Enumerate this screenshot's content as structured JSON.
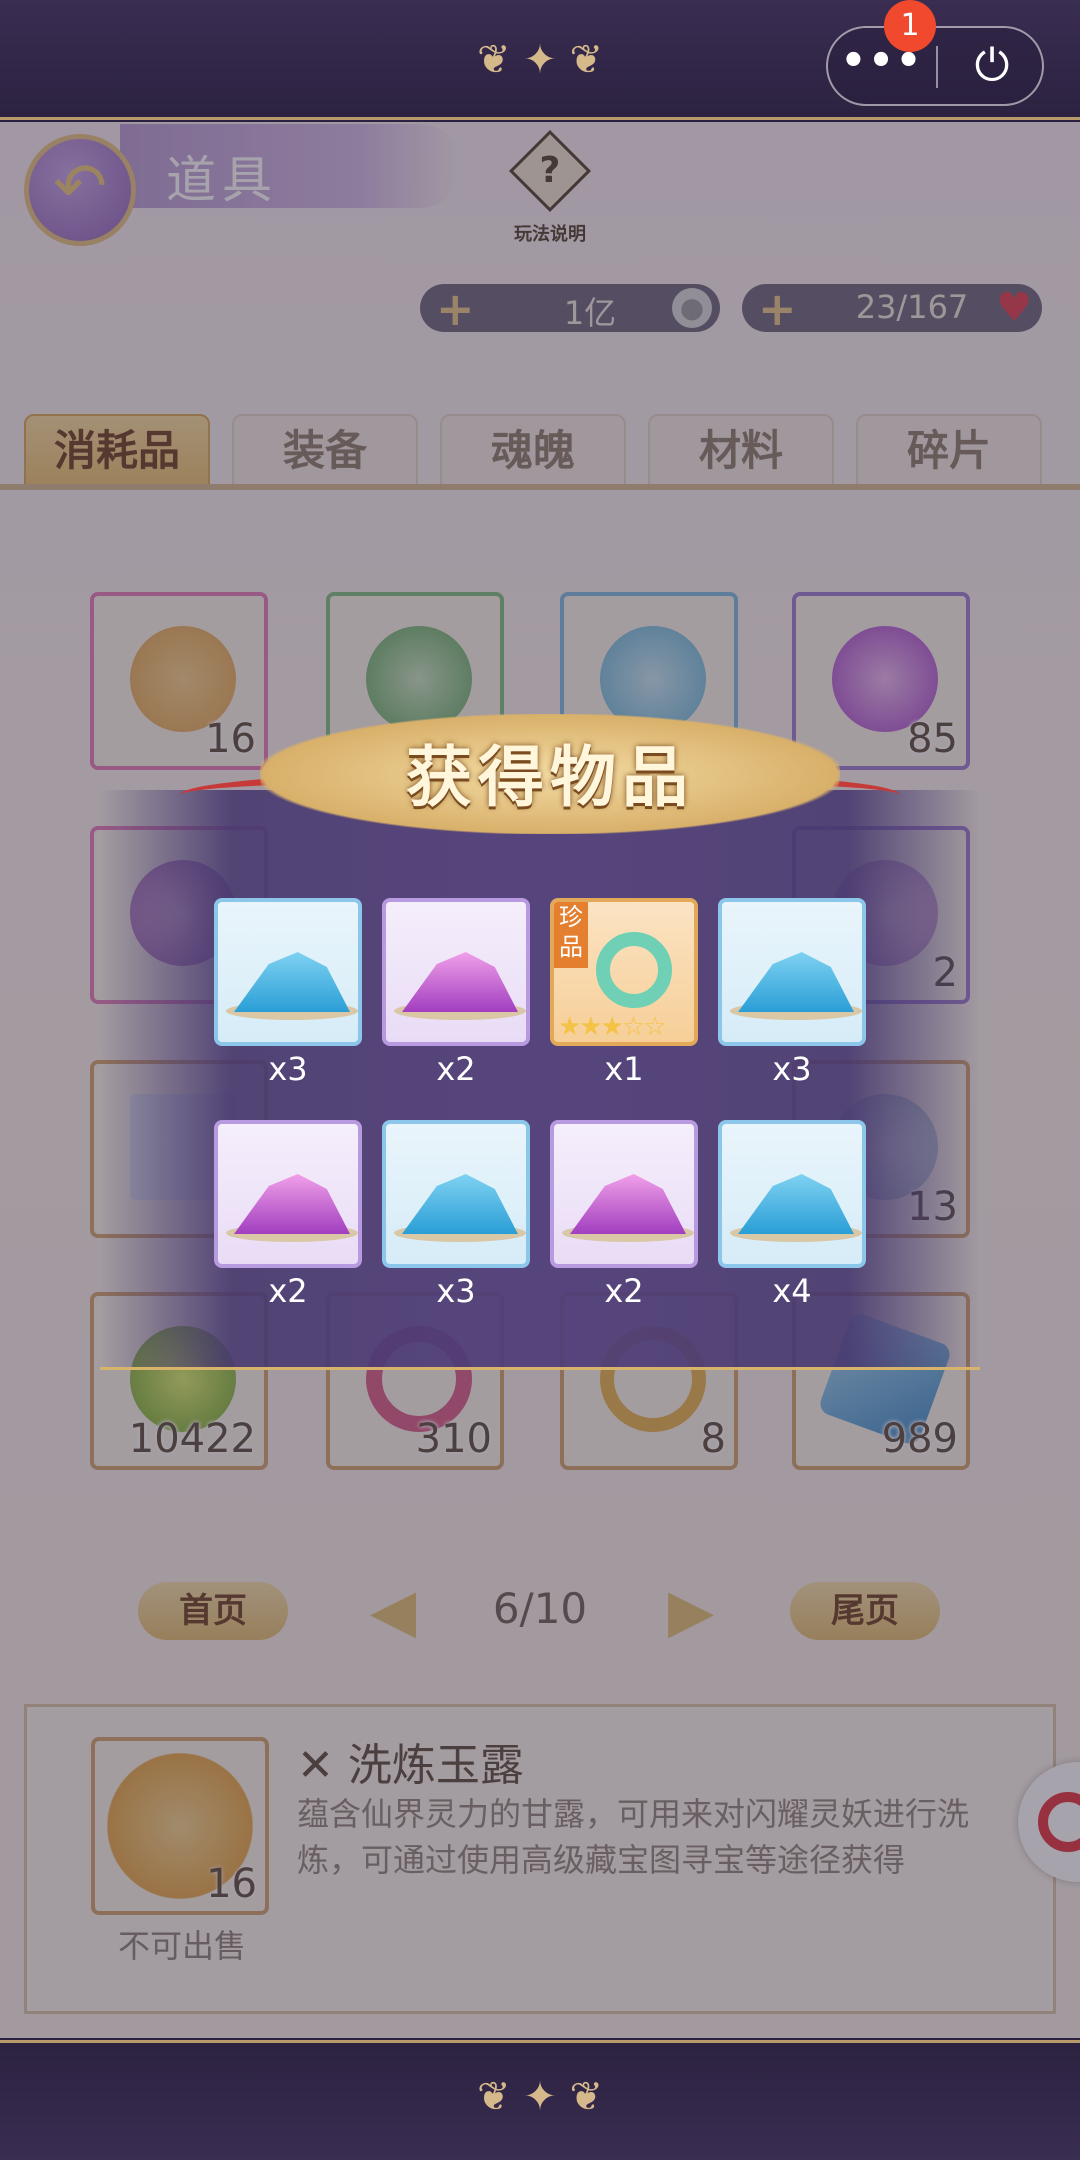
{
  "system": {
    "badge_count": "1",
    "more_icon": "ellipsis-icon",
    "power_icon": "power-icon"
  },
  "header": {
    "title": "道具",
    "help_label": "玩法说明",
    "help_mark": "?",
    "back_icon": "back-arrow-icon"
  },
  "resources": {
    "silver": "1亿",
    "stamina": "23/167",
    "plus": "+"
  },
  "tabs": [
    "消耗品",
    "装备",
    "魂魄",
    "材料",
    "碎片"
  ],
  "inventory": {
    "visible_counts": [
      "16",
      "85",
      "2",
      "13",
      "10422",
      "310",
      "8",
      "989"
    ]
  },
  "pager": {
    "first": "首页",
    "last": "尾页",
    "page": "6/10",
    "prev_icon": "◀",
    "next_icon": "▶"
  },
  "detail": {
    "count": "16",
    "sell_status": "不可出售",
    "name": "✕ 洗炼玉露",
    "description": "蕴含仙界灵力的甘露，可用来对闪耀灵妖进行洗炼，可通过使用高级藏宝图寻宝等途径获得"
  },
  "reward": {
    "title": "获得物品",
    "items": [
      {
        "type": "blue",
        "qty": "x3"
      },
      {
        "type": "purple",
        "qty": "x2"
      },
      {
        "type": "gold",
        "qty": "x1",
        "tag": "珍品",
        "stars": "★★★☆☆"
      },
      {
        "type": "blue",
        "qty": "x3"
      },
      {
        "type": "purple",
        "qty": "x2"
      },
      {
        "type": "blue",
        "qty": "x3"
      },
      {
        "type": "purple",
        "qty": "x2"
      },
      {
        "type": "blue",
        "qty": "x4"
      }
    ]
  },
  "colors": {
    "frame": "#2c2240",
    "gold_accent": "#d8b36a",
    "dialog_band": "#50407a",
    "badge": "#f0492e"
  }
}
